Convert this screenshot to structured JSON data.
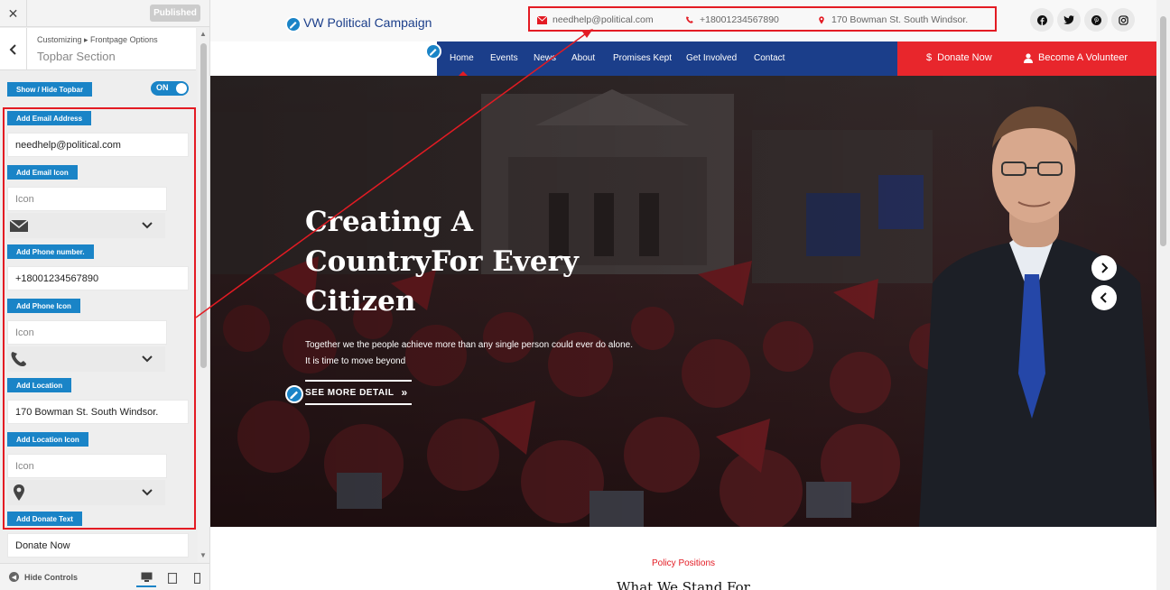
{
  "customizer": {
    "close_label": "✕",
    "published_label": "Published",
    "breadcrumb": "Customizing ▸ Frontpage Options",
    "section_title": "Topbar Section",
    "show_hide_label": "Show / Hide Topbar",
    "toggle_label": "ON",
    "email_label": "Add Email Address",
    "email_value": "needhelp@political.com",
    "email_icon_label": "Add Email Icon",
    "icon_placeholder": "Icon",
    "phone_label": "Add Phone number.",
    "phone_value": "+18001234567890",
    "phone_icon_label": "Add Phone Icon",
    "location_label": "Add Location",
    "location_value": "170 Bowman St. South Windsor.",
    "location_icon_label": "Add Location Icon",
    "donate_text_label": "Add Donate Text",
    "donate_text_value": "Donate Now",
    "hide_controls_label": "Hide Controls",
    "icons": {
      "email": "envelope-icon",
      "phone": "phone-icon",
      "location": "map-marker-icon"
    }
  },
  "site": {
    "logo_text": "VW Political Campaign",
    "topbar": {
      "email": "needhelp@political.com",
      "phone": "+18001234567890",
      "address": "170 Bowman St. South Windsor."
    },
    "social": [
      "facebook-icon",
      "twitter-icon",
      "pinterest-icon",
      "instagram-icon"
    ],
    "nav": [
      "Home",
      "Events",
      "News",
      "About",
      "Promises Kept",
      "Get Involved",
      "Contact"
    ],
    "donate_button": "Donate Now",
    "volunteer_button": "Become A Volunteer",
    "hero": {
      "title": "Creating A CountryFor Every Citizen",
      "subtitle": "Together we the people achieve more than any single person could ever do alone. It is time to move beyond",
      "button": "SEE MORE DETAIL"
    },
    "policy_label": "Policy Positions",
    "policy_title": "What We Stand For"
  },
  "colors": {
    "accent_blue": "#1a84c7",
    "nav_blue": "#1b3e8a",
    "brand_red": "#e8262c",
    "highlight_red": "#e31b23"
  }
}
